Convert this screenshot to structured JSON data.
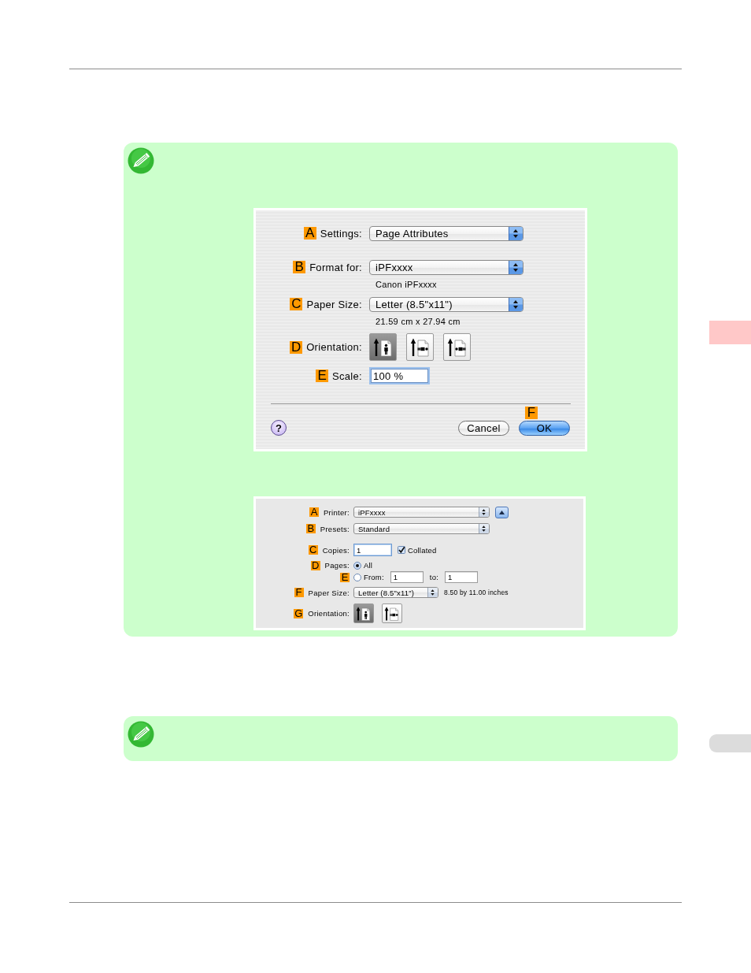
{
  "page_setup_dialog": {
    "rows": [
      {
        "kind": "select",
        "marker": "A",
        "label": "Settings:",
        "value": "Page Attributes"
      },
      {
        "kind": "select",
        "marker": "B",
        "label": "Format for:",
        "value": "iPFxxxx",
        "caption": "Canon iPFxxxx"
      },
      {
        "kind": "select",
        "marker": "C",
        "label": "Paper Size:",
        "value": "Letter (8.5\"x11\")",
        "caption": "21.59 cm x 27.94 cm"
      },
      {
        "kind": "orientation",
        "marker": "D",
        "label": "Orientation:",
        "options": [
          {
            "kind": "portrait",
            "selected": true
          },
          {
            "kind": "landscape",
            "selected": false
          },
          {
            "kind": "reverse_landscape",
            "selected": false
          }
        ]
      },
      {
        "kind": "input",
        "marker": "E",
        "label": "Scale:",
        "value": "100 %"
      }
    ],
    "help_button": "?",
    "buttons": [
      {
        "label": "Cancel",
        "default": false
      },
      {
        "label": "OK",
        "default": true,
        "marker": "F"
      }
    ]
  },
  "print_dialog": {
    "rows": [
      {
        "kind": "select",
        "marker": "A",
        "label": "Printer:",
        "value": "iPFxxxx",
        "disclosure": true
      },
      {
        "kind": "select",
        "marker": "B",
        "label": "Presets:",
        "value": "Standard"
      },
      {
        "kind": "copies",
        "marker": "C",
        "label": "Copies:",
        "value": "1",
        "checkbox": {
          "label": "Collated",
          "checked": true
        }
      },
      {
        "kind": "radio",
        "marker": "D",
        "label": "Pages:",
        "option": "All",
        "selected": true
      },
      {
        "kind": "range",
        "marker": "E",
        "option": "From:",
        "selected": false,
        "from": "1",
        "to_label": "to:",
        "to": "1"
      },
      {
        "kind": "select",
        "marker": "F",
        "label": "Paper Size:",
        "value": "Letter (8.5\"x11\")",
        "caption": "8.50 by 11.00 inches"
      },
      {
        "kind": "orientation",
        "marker": "G",
        "label": "Orientation:",
        "options": [
          {
            "kind": "portrait",
            "selected": true
          },
          {
            "kind": "landscape",
            "selected": false
          }
        ]
      }
    ]
  },
  "side_tabs": [
    {
      "selected": true
    },
    {
      "selected": false
    }
  ]
}
